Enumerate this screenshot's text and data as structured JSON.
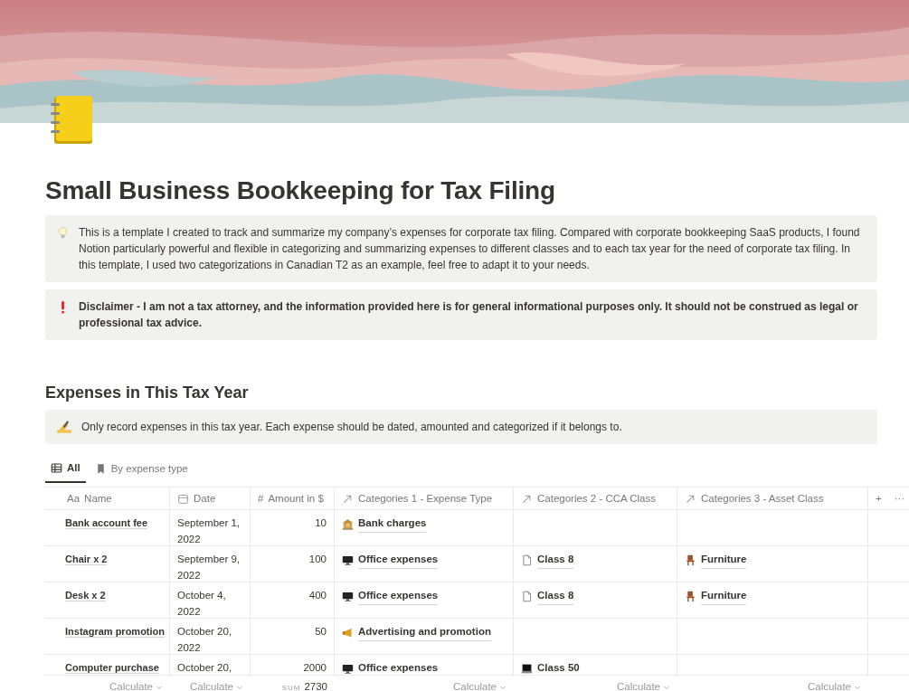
{
  "title": "Small Business Bookkeeping for Tax Filing",
  "callouts": [
    {
      "kind": "bulb",
      "text": "This is a template I created to track and summarize my company’s expenses for corporate tax filing. Compared with corporate bookkeeping SaaS products, I found Notion particularly powerful and flexible in categorizing and summarizing expenses to different classes and to each tax year for the need of corporate tax filing. In this template, I used two categorizations in Canadian T2 as an example, feel free to adapt it to your needs.",
      "bold": false
    },
    {
      "kind": "alert",
      "text": "Disclaimer - I am not a tax attorney, and the information provided here is for general informational purposes only. It should not be construed as legal or professional tax advice.",
      "bold": true
    }
  ],
  "section": {
    "heading": "Expenses in This Tax Year",
    "callout": {
      "kind": "writing",
      "text": "Only record expenses in this tax year. Each expense should be dated, amounted and categorized if it belongs to."
    }
  },
  "views": [
    {
      "label": "All",
      "kind": "table",
      "selected": true
    },
    {
      "label": "By expense type",
      "kind": "bookmark",
      "selected": false
    }
  ],
  "table": {
    "columns": [
      {
        "kind": "text",
        "prefix": "Aa",
        "label": "Name"
      },
      {
        "kind": "date",
        "label": "Date"
      },
      {
        "kind": "number",
        "prefix": "#",
        "label": "Amount in $"
      },
      {
        "kind": "relation",
        "label": "Categories 1 - Expense Type"
      },
      {
        "kind": "relation",
        "label": "Categories 2 - CCA Class"
      },
      {
        "kind": "relation",
        "label": "Categories 3 - Asset Class"
      }
    ],
    "add_column": "+",
    "more": "···",
    "rows": [
      {
        "name": "Bank account fee",
        "date": "September 1, 2022",
        "amount": "10",
        "cat1": {
          "kind": "bank",
          "label": "Bank charges"
        }
      },
      {
        "name": "Chair x 2",
        "date": "September 9, 2022",
        "amount": "100",
        "cat1": {
          "kind": "monitor",
          "label": "Office expenses"
        },
        "cat2": {
          "kind": "page",
          "label": "Class 8"
        },
        "cat3": {
          "kind": "chair",
          "label": "Furniture"
        }
      },
      {
        "name": "Desk x 2",
        "date": "October 4, 2022",
        "amount": "400",
        "cat1": {
          "kind": "monitor",
          "label": "Office expenses"
        },
        "cat2": {
          "kind": "page",
          "label": "Class 8"
        },
        "cat3": {
          "kind": "chair",
          "label": "Furniture"
        }
      },
      {
        "name": "Instagram promotion",
        "date": "October 20, 2022",
        "amount": "50",
        "cat1": {
          "kind": "megaphone",
          "label": "Advertising and promotion"
        }
      },
      {
        "name": "Computer purchase",
        "date": "October 20,",
        "amount": "2000",
        "cat1": {
          "kind": "monitor",
          "label": "Office expenses"
        },
        "cat2": {
          "kind": "laptop",
          "label": "Class 50"
        }
      }
    ],
    "footer": [
      {
        "kind": "calc",
        "label": "Calculate"
      },
      {
        "kind": "calc",
        "label": "Calculate"
      },
      {
        "kind": "sum",
        "label": "SUM",
        "value": "2730"
      },
      {
        "kind": "calc",
        "label": "Calculate"
      },
      {
        "kind": "calc",
        "label": "Calculate"
      },
      {
        "kind": "calc",
        "label": "Calculate"
      }
    ]
  }
}
